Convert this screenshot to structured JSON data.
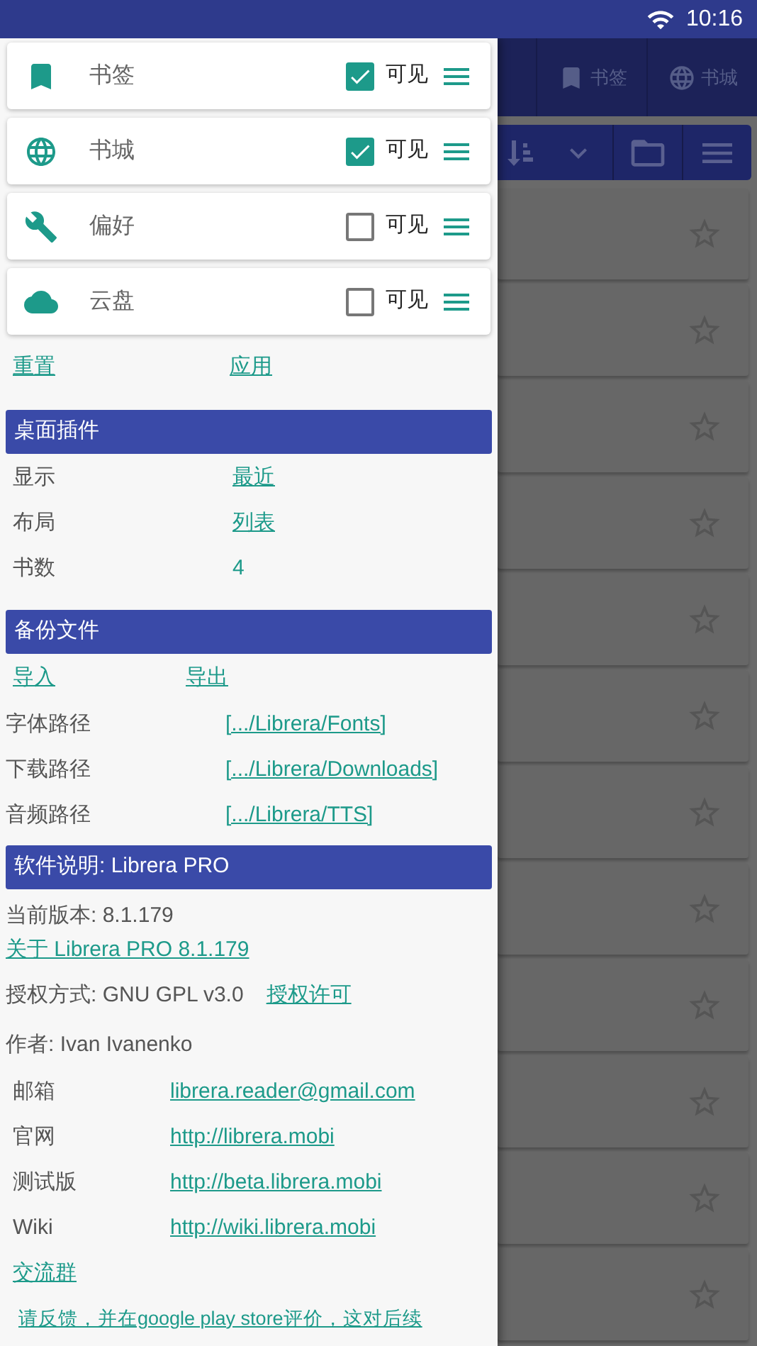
{
  "status_bar": {
    "time": "10:16"
  },
  "drawer": {
    "sections_list": [
      {
        "label": "书签",
        "visible_label": "可见",
        "checked": true
      },
      {
        "label": "书城",
        "visible_label": "可见",
        "checked": true
      },
      {
        "label": "偏好",
        "visible_label": "可见",
        "checked": false
      },
      {
        "label": "云盘",
        "visible_label": "可见",
        "checked": false
      }
    ],
    "reset": "重置",
    "apply": "应用",
    "widget": {
      "title": "桌面插件",
      "rows": [
        {
          "label": "显示",
          "value": "最近",
          "kind": "link"
        },
        {
          "label": "布局",
          "value": "列表",
          "kind": "link"
        },
        {
          "label": "书数",
          "value": "4",
          "kind": "text"
        }
      ]
    },
    "backup": {
      "title": "备份文件",
      "import": "导入",
      "export": "导出",
      "paths": [
        {
          "label": "字体路径",
          "value": "[.../Librera/Fonts]"
        },
        {
          "label": "下载路径",
          "value": "[.../Librera/Downloads]"
        },
        {
          "label": "音频路径",
          "value": "[.../Librera/TTS]"
        }
      ]
    },
    "about": {
      "title": "软件说明: Librera PRO",
      "version": "当前版本: 8.1.179",
      "about_link": "关于 Librera PRO 8.1.179",
      "license": "授权方式: GNU GPL v3.0",
      "license_link": "授权许可",
      "author": "作者: Ivan Ivanenko",
      "contacts": [
        {
          "label": "邮箱",
          "value": "librera.reader@gmail.com"
        },
        {
          "label": "官网",
          "value": "http://librera.mobi"
        },
        {
          "label": "测试版",
          "value": "http://beta.librera.mobi"
        },
        {
          "label": "Wiki",
          "value": "http://wiki.librera.mobi"
        }
      ],
      "group_link": "交流群",
      "feedback": "请反馈，并在google play store评价，这对后续"
    }
  },
  "background": {
    "tabs": [
      {
        "label": "书签",
        "selected": false
      },
      {
        "label": "书城",
        "selected": false
      }
    ],
    "books": [
      {
        "starred": false
      },
      {
        "starred": false
      },
      {
        "starred": false
      },
      {
        "starred": false
      },
      {
        "starred": false
      },
      {
        "starred": false
      },
      {
        "starred": false
      },
      {
        "starred": false
      },
      {
        "starred": false
      },
      {
        "starred": false
      },
      {
        "starred": false
      },
      {
        "starred": false
      }
    ]
  }
}
